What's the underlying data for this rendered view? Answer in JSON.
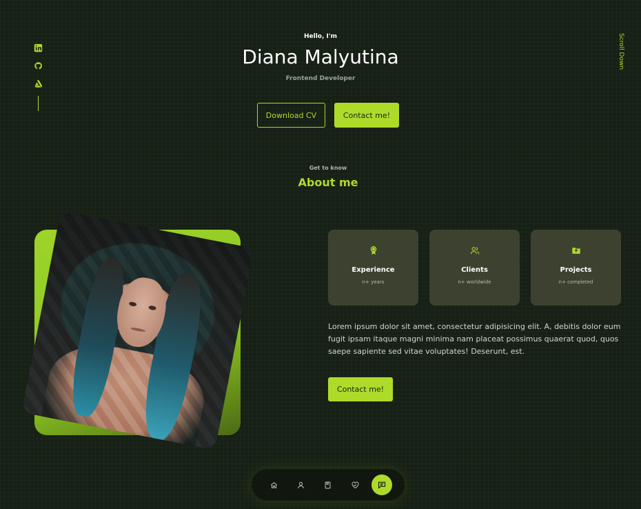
{
  "hero": {
    "greeting": "Hello, I'm",
    "name": "Diana Malyutina",
    "role": "Frontend Developer",
    "download_label": "Download CV",
    "contact_label": "Contact me!"
  },
  "socials": [
    {
      "icon": "linkedin-icon"
    },
    {
      "icon": "github-icon"
    },
    {
      "icon": "artstation-icon"
    }
  ],
  "scroll_down": "Scroll Down",
  "about": {
    "subtitle": "Get to know",
    "title": "About me",
    "cards": [
      {
        "icon": "award-icon",
        "title": "Experience",
        "sub": "n+ years"
      },
      {
        "icon": "users-icon",
        "title": "Clients",
        "sub": "n+ worldwide"
      },
      {
        "icon": "folder-icon",
        "title": "Projects",
        "sub": "n+ completed"
      }
    ],
    "bio": "Lorem ipsum dolor sit amet, consectetur adipisicing elit. A, debitis dolor eum fugit ipsam itaque magni minima nam placeat possimus quaerat quod, quos saepe sapiente sed vitae voluptates! Deserunt, est.",
    "contact_label": "Contact me!"
  },
  "nav": {
    "items": [
      "home-icon",
      "user-icon",
      "book-icon",
      "heart-handshake-icon",
      "message-icon"
    ],
    "active": "message-icon"
  },
  "colors": {
    "accent": "#aedb2a",
    "background": "#172015",
    "card": "#3d4230"
  }
}
